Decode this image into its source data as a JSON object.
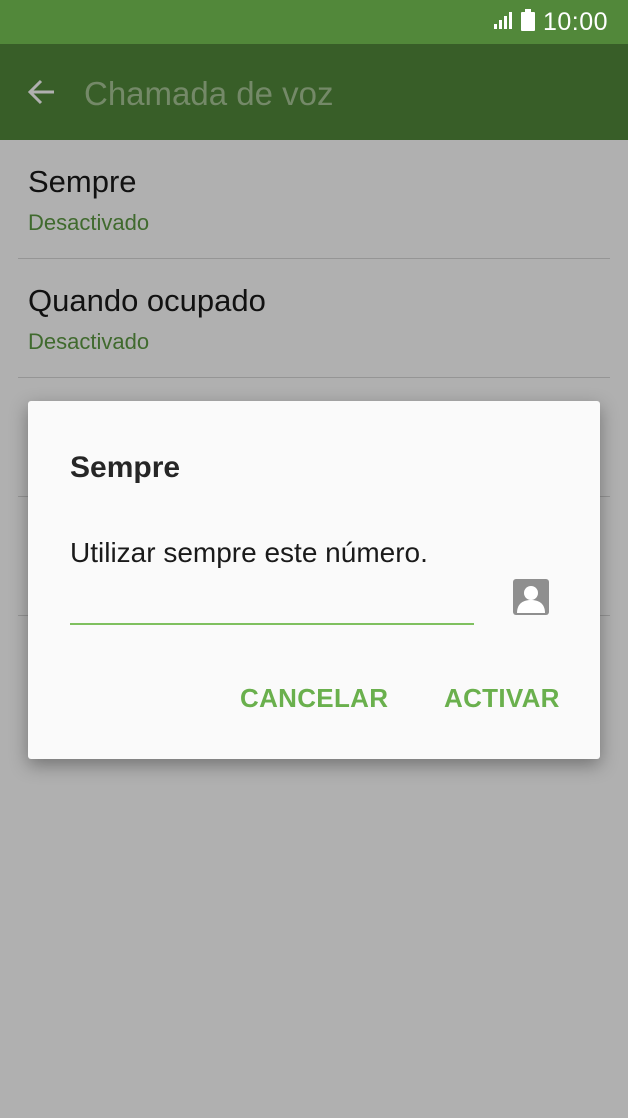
{
  "status_bar": {
    "time": "10:00",
    "icons": [
      "signal-icon",
      "battery-icon"
    ]
  },
  "app_bar": {
    "back_icon": "arrow-left-icon",
    "title": "Chamada de voz"
  },
  "list": {
    "items": [
      {
        "title": "Sempre",
        "subtitle": "Desactivado"
      },
      {
        "title": "Quando ocupado",
        "subtitle": "Desactivado"
      },
      {
        "title": "",
        "subtitle": ""
      },
      {
        "title": "",
        "subtitle": ""
      }
    ]
  },
  "dialog": {
    "title": "Sempre",
    "message": "Utilizar sempre este número.",
    "input": {
      "value": "",
      "placeholder": ""
    },
    "contact_icon": "contact-picker-icon",
    "cancel_label": "CANCELAR",
    "activate_label": "ACTIVAR"
  },
  "colors": {
    "header": "#52883a",
    "accent": "#6ab04d",
    "subtitle": "#5d9a43",
    "scrim": "rgba(0,0,0,0.31)"
  }
}
